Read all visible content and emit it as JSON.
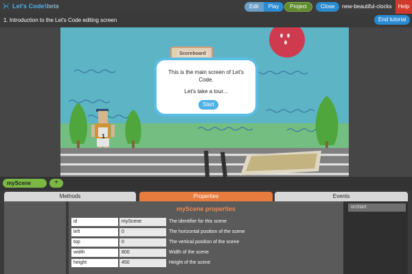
{
  "app": {
    "logo_text": "Let's Code!",
    "logo_suffix": "beta",
    "doc_name": "new-beautiful-clocks"
  },
  "toolbar": {
    "edit_label": "Edit",
    "play_label": "Play",
    "project_label": "Project",
    "close_label": "Close",
    "help_label": "Help"
  },
  "tutorial": {
    "title": "1. Introduction to the Let's Code editing screen",
    "end_label": "End tutorial",
    "dialog_line1": "This is the main screen of Let's Code.",
    "dialog_line2": "Let's take a tour...",
    "start_label": "Start"
  },
  "stage": {
    "scoreboard_title": "Scoreboard",
    "scoreboard_value": "- - - - - - - - -",
    "runner_number": "1"
  },
  "scenes": {
    "active": "myScene",
    "add_label": "+"
  },
  "panel": {
    "tabs": {
      "methods": "Methods",
      "properties": "Properties",
      "events": "Events"
    },
    "properties_title": "myScene properties",
    "properties": [
      {
        "key": "id",
        "value": "myScene",
        "desc": "The identifier for this scene"
      },
      {
        "key": "left",
        "value": "0",
        "desc": "The horizontal position of the scene"
      },
      {
        "key": "top",
        "value": "0",
        "desc": "The vertical position of the scene"
      },
      {
        "key": "width",
        "value": "800",
        "desc": "Width of the scene"
      },
      {
        "key": "height",
        "value": "450",
        "desc": "Height of the scene"
      }
    ],
    "events": [
      "onStart"
    ]
  },
  "colors": {
    "accent": "#2b8bd0",
    "help": "#d13a2a",
    "properties_tab": "#e87c3e",
    "scene_tab": "#7ab843"
  }
}
